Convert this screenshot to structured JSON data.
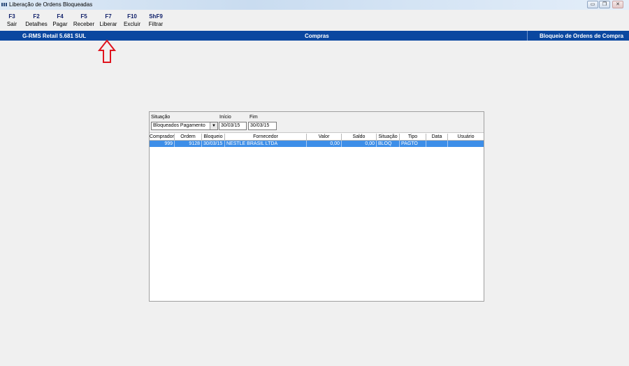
{
  "window": {
    "title": "Liberação de Ordens Bloqueadas"
  },
  "toolbar": [
    {
      "key": "F3",
      "label": "Sair"
    },
    {
      "key": "F2",
      "label": "Detalhes"
    },
    {
      "key": "F4",
      "label": "Pagar"
    },
    {
      "key": "F5",
      "label": "Receber"
    },
    {
      "key": "F7",
      "label": "Liberar"
    },
    {
      "key": "F10",
      "label": "Excluir"
    },
    {
      "key": "ShF9",
      "label": "Filtrar"
    }
  ],
  "status_bar": {
    "system": "G-RMS Retail 5.681 SUL",
    "module": "Compras",
    "screen": "Bloqueio de Ordens de Compra"
  },
  "filter": {
    "situacao_label": "Situação",
    "situacao_value": "Bloqueados Pagamento",
    "inicio_label": "Início",
    "inicio_value": "30/03/15",
    "fim_label": "Fim",
    "fim_value": "30/03/15"
  },
  "table": {
    "columns": [
      "Comprador",
      "Ordem",
      "Bloqueio",
      "Fornecedor",
      "Valor",
      "Saldo",
      "Situação",
      "Tipo",
      "Data",
      "Usuário"
    ],
    "rows": [
      {
        "comprador": "999",
        "ordem": "9128",
        "bloqueio": "30/03/15",
        "fornecedor": "NESTLE BRASIL LTDA",
        "valor": "0,00",
        "saldo": "0,00",
        "situacao": "BLOQ",
        "tipo": "PAGTO",
        "data": "",
        "usuario": ""
      }
    ]
  },
  "colors": {
    "accent_bar": "#0a47a0",
    "selection": "#3d8ee8",
    "arrow": "#e0141e"
  }
}
